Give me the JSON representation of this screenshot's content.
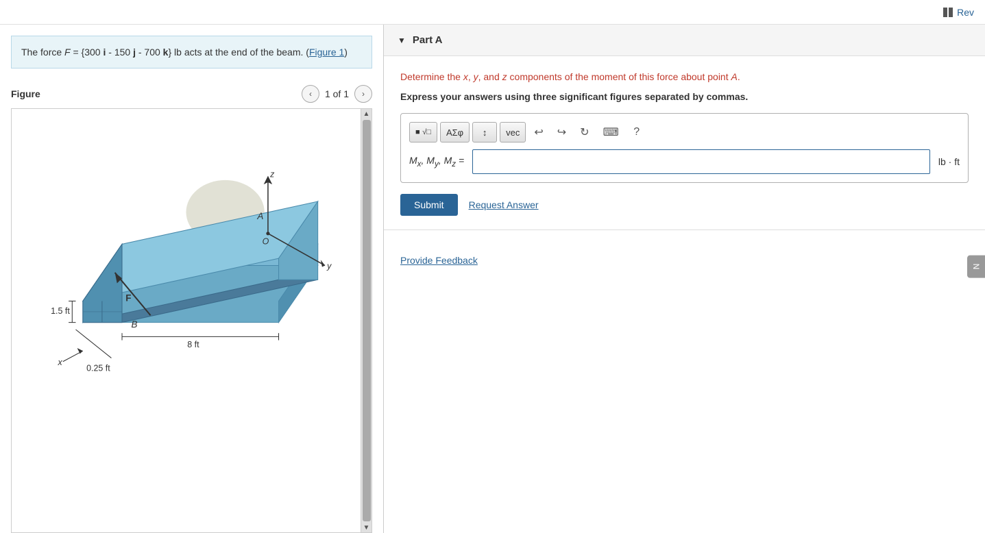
{
  "topbar": {
    "rev_label": "Rev"
  },
  "left": {
    "problem": {
      "text_before": "The force ",
      "force_label": "F",
      "text_eq": " = {300 ",
      "i_label": "i",
      "text_minus1": " - 150 ",
      "j_label": "j",
      "text_minus2": " - 700 ",
      "k_label": "k",
      "text_after": "} lb acts at the end of the beam. (",
      "figure_link": "Figure 1",
      "text_end": ")"
    },
    "figure": {
      "title": "Figure",
      "count": "1 of 1"
    }
  },
  "right": {
    "part": {
      "label": "Part A",
      "question": "Determine the x, y, and z components of the moment of this force about point A.",
      "instruction": "Express your answers using three significant figures separated by commas.",
      "toolbar": {
        "btn_matrix": "√□",
        "btn_sigma": "ΑΣφ",
        "btn_arrows": "↕",
        "btn_vec": "vec",
        "btn_undo": "↩",
        "btn_redo": "↪",
        "btn_refresh": "↻",
        "btn_keyboard": "⌨",
        "btn_help": "?"
      },
      "answer_label": "Mx, My, Mz =",
      "answer_placeholder": "",
      "unit": "lb · ft",
      "submit_label": "Submit",
      "request_answer_label": "Request Answer",
      "feedback_label": "Provide Feedback"
    }
  },
  "side_tab": {
    "label": "N"
  }
}
